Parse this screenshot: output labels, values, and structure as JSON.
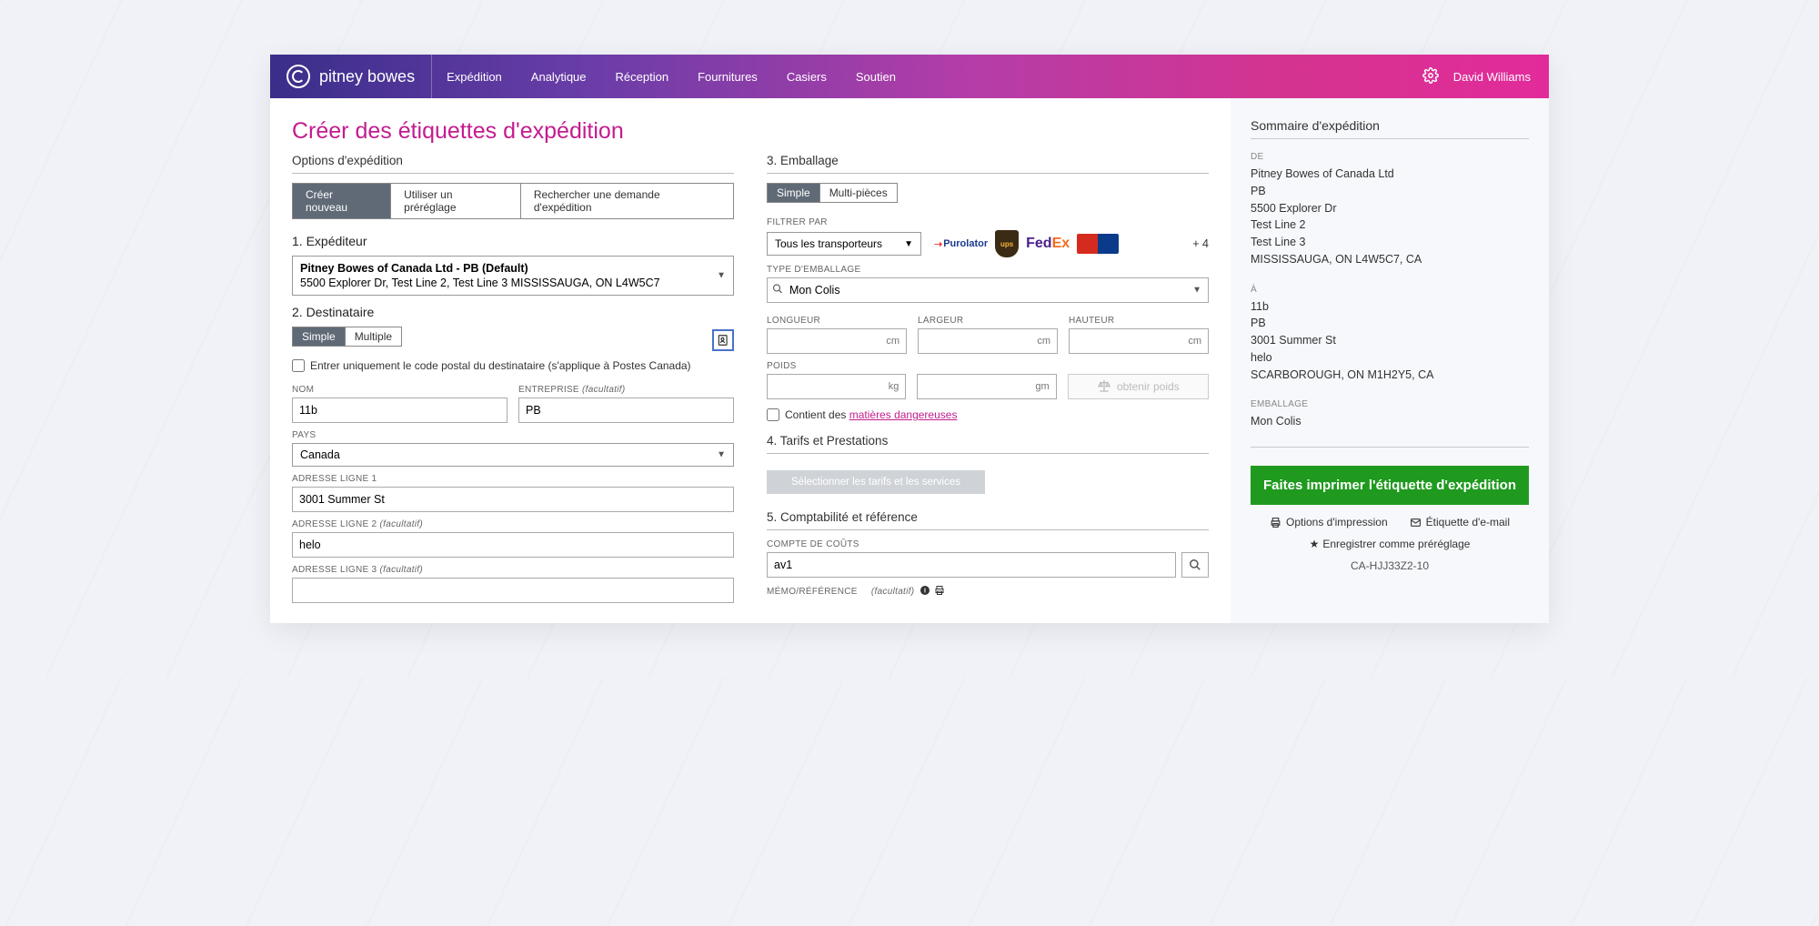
{
  "brand": "pitney bowes",
  "nav": {
    "items": [
      "Expédition",
      "Analytique",
      "Réception",
      "Fournitures",
      "Casiers",
      "Soutien"
    ]
  },
  "user": "David Williams",
  "page_title": "Créer des étiquettes d'expédition",
  "options_label": "Options d'expédition",
  "tabs": {
    "create": "Créer nouveau",
    "preset": "Utiliser un préréglage",
    "search": "Rechercher une demande d'expédition"
  },
  "sender": {
    "title": "1. Expéditeur",
    "line1": "Pitney Bowes of Canada Ltd - PB (Default)",
    "line2": "5500 Explorer Dr, Test Line 2, Test Line 3 MISSISSAUGA, ON L4W5C7"
  },
  "recipient": {
    "title": "2. Destinataire",
    "tab_simple": "Simple",
    "tab_multiple": "Multiple",
    "postal_only": "Entrer uniquement le code postal du destinataire (s'applique à Postes Canada)",
    "labels": {
      "nom": "NOM",
      "entreprise": "ENTREPRISE",
      "entreprise_opt": "(facultatif)",
      "pays": "PAYS",
      "addr1": "ADRESSE LIGNE 1",
      "addr2": "ADRESSE LIGNE 2",
      "addr2_opt": "(facultatif)",
      "addr3": "ADRESSE LIGNE 3",
      "addr3_opt": "(facultatif)"
    },
    "values": {
      "nom": "11b",
      "entreprise": "PB",
      "pays": "Canada",
      "addr1": "3001 Summer St",
      "addr2": "helo",
      "addr3": ""
    }
  },
  "packaging": {
    "title": "3. Emballage",
    "tab_simple": "Simple",
    "tab_multi": "Multi-pièces",
    "filter_label": "FILTRER PAR",
    "all_carriers": "Tous les transporteurs",
    "plus4": "+ 4",
    "type_label": "TYPE D'EMBALLAGE",
    "type_value": "Mon Colis",
    "dims": {
      "longueur": "LONGUEUR",
      "largeur": "LARGEUR",
      "hauteur": "HAUTEUR",
      "unit": "cm"
    },
    "weight": {
      "label": "POIDS",
      "kg": "kg",
      "gm": "gm",
      "get": "obtenir poids"
    },
    "hazmat_prefix": "Contient des ",
    "hazmat_link": "matières dangereuses"
  },
  "rates": {
    "title": "4. Tarifs et Prestations",
    "button": "Sélectionner les tarifs et les services"
  },
  "accounting": {
    "title": "5. Comptabilité et référence",
    "cost_label": "COMPTE DE COÛTS",
    "cost_value": "av1",
    "memo_label": "MÉMO/RÉFÉRENCE",
    "memo_opt": "(facultatif)"
  },
  "summary": {
    "title": "Sommaire d'expédition",
    "from_label": "DE",
    "from": {
      "l1": "Pitney Bowes of Canada Ltd",
      "l2": "PB",
      "l3": "5500 Explorer Dr",
      "l4": "Test Line 2",
      "l5": "Test Line 3",
      "l6": "MISSISSAUGA, ON L4W5C7, CA"
    },
    "to_label": "À",
    "to": {
      "l1": "11b",
      "l2": "PB",
      "l3": "3001 Summer St",
      "l4": "helo",
      "l5": "SCARBOROUGH, ON M1H2Y5, CA"
    },
    "pkg_label": "EMBALLAGE",
    "pkg_value": "Mon Colis",
    "print_btn": "Faites imprimer l'étiquette d'expédition",
    "print_options": "Options d'impression",
    "email_label": "Étiquette d'e-mail",
    "save_preset": "Enregistrer comme préréglage",
    "tracking": "CA-HJJ33Z2-10"
  }
}
